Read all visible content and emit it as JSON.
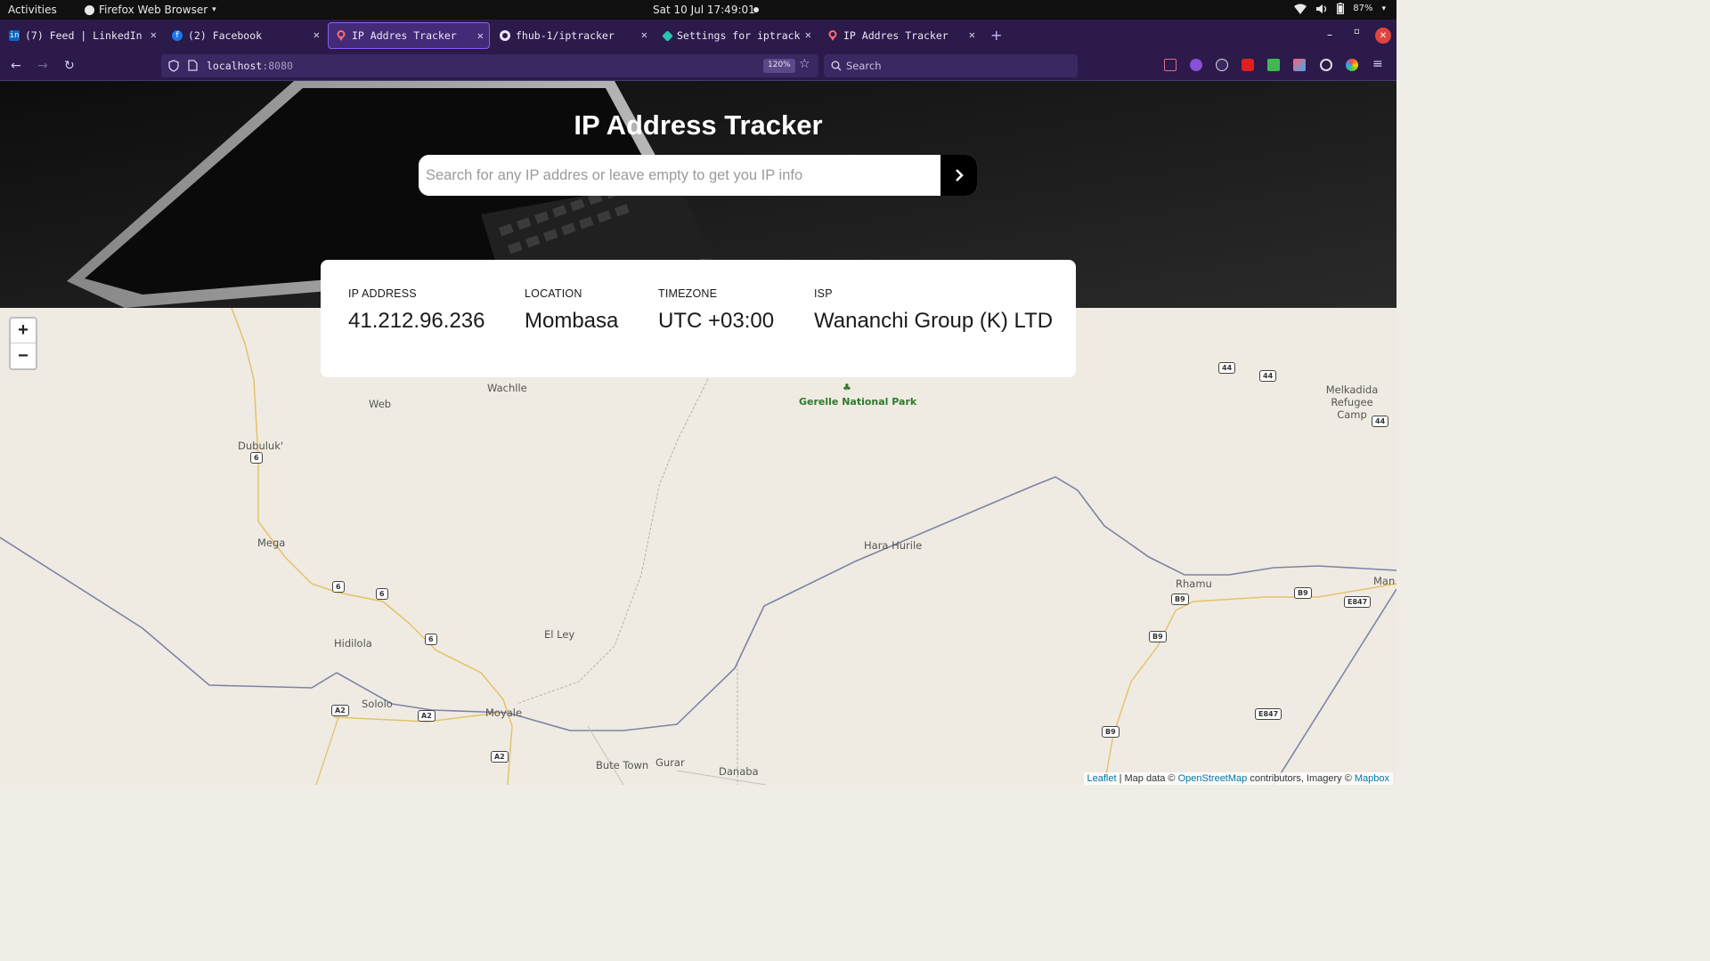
{
  "system_bar": {
    "activities": "Activities",
    "app_name": "Firefox Web Browser",
    "clock": "Sat 10 Jul  17:49:01",
    "battery": "87%"
  },
  "browser": {
    "tabs": [
      {
        "title": "(7) Feed | LinkedIn",
        "icon": "linkedin-icon"
      },
      {
        "title": "(2) Facebook",
        "icon": "facebook-icon"
      },
      {
        "title": "IP Addres Tracker",
        "icon": "location-pin-icon",
        "active": true
      },
      {
        "title": "fhub-1/iptracker",
        "icon": "github-icon"
      },
      {
        "title": "Settings for iptracker",
        "icon": "netlify-icon"
      },
      {
        "title": "IP Addres Tracker",
        "icon": "location-pin-icon"
      }
    ],
    "url_host": "localhost",
    "url_port": ":8080",
    "zoom": "120%",
    "search_placeholder": "Search"
  },
  "app": {
    "title": "IP Address Tracker",
    "search_placeholder": "Search for any IP addres or leave empty to get you IP info",
    "info": {
      "ip_label": "IP ADDRESS",
      "ip_value": "41.212.96.236",
      "location_label": "LOCATION",
      "location_value": "Mombasa",
      "timezone_label": "TIMEZONE",
      "timezone_value": "UTC +03:00",
      "isp_label": "ISP",
      "isp_value": "Wananchi Group (K) LTD"
    }
  },
  "map": {
    "zoom_in": "+",
    "zoom_out": "−",
    "attribution": {
      "leaflet": "Leaflet",
      "sep1": " | Map data © ",
      "osm": "OpenStreetMap",
      "sep2": " contributors, Imagery © ",
      "mapbox": "Mapbox"
    },
    "places": [
      "Wachlle",
      "Web",
      "Gerelle National Park",
      "Melkadida Refugee Camp",
      "Dubuluk'",
      "Mega",
      "Hara Hurile",
      "Rhamu",
      "Man",
      "Hidilola",
      "El Ley",
      "Sololo",
      "Moyale",
      "Bute Town",
      "Gurar",
      "Danaba"
    ],
    "road_shields": [
      "6",
      "6",
      "6",
      "6",
      "A2",
      "A2",
      "A2",
      "44",
      "44",
      "44",
      "B9",
      "B9",
      "B9",
      "B9",
      "E847",
      "E847"
    ]
  }
}
